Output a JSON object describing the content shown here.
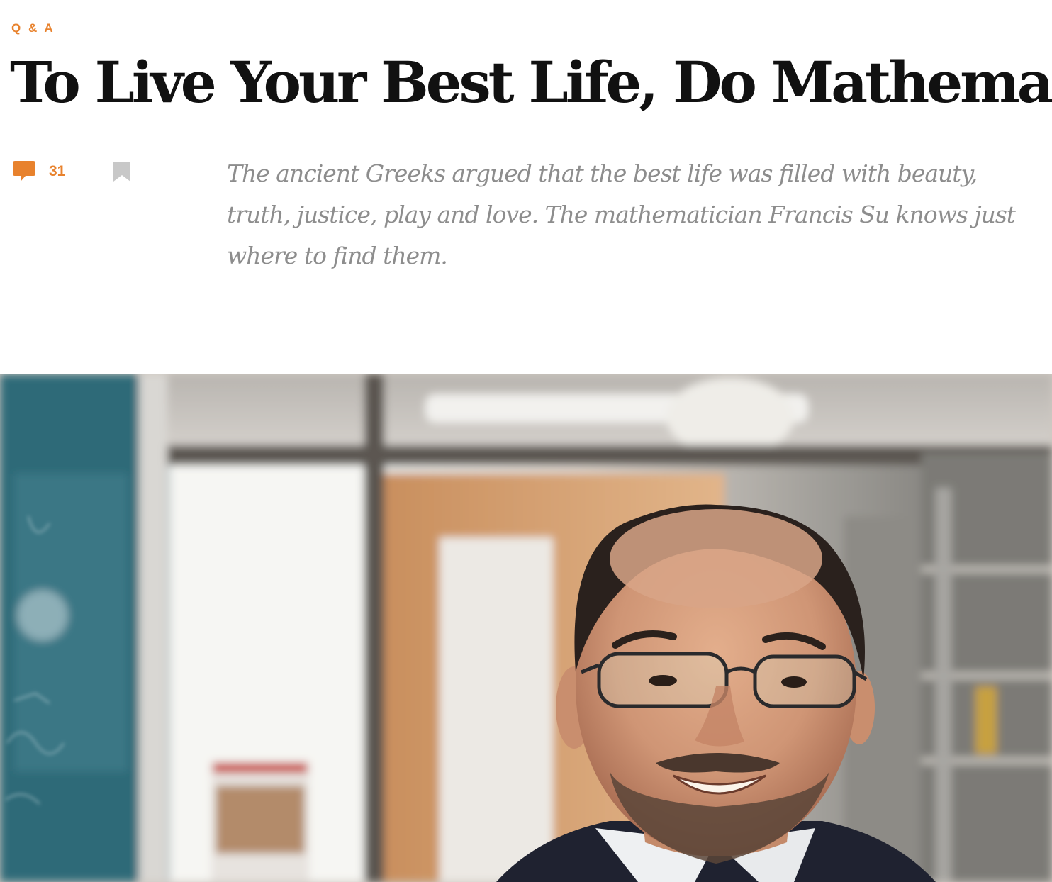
{
  "article": {
    "kicker": "Q & A",
    "title": "To Live Your Best Life, Do Mathematics",
    "comment_count": "31",
    "dek": "The ancient Greeks argued that the best life was filled with beauty, truth, justice, play and love. The mathematician Francis Su knows just where to find them."
  },
  "icons": {
    "comment": "speech-bubble-icon",
    "bookmark": "bookmark-icon"
  },
  "colors": {
    "accent": "#e8822d",
    "headline": "#111111",
    "dek": "#8d8d8d",
    "bookmark": "#c8c8c8",
    "divider": "#cfcfcf"
  },
  "hero_image": {
    "subject": "portrait-photo"
  }
}
